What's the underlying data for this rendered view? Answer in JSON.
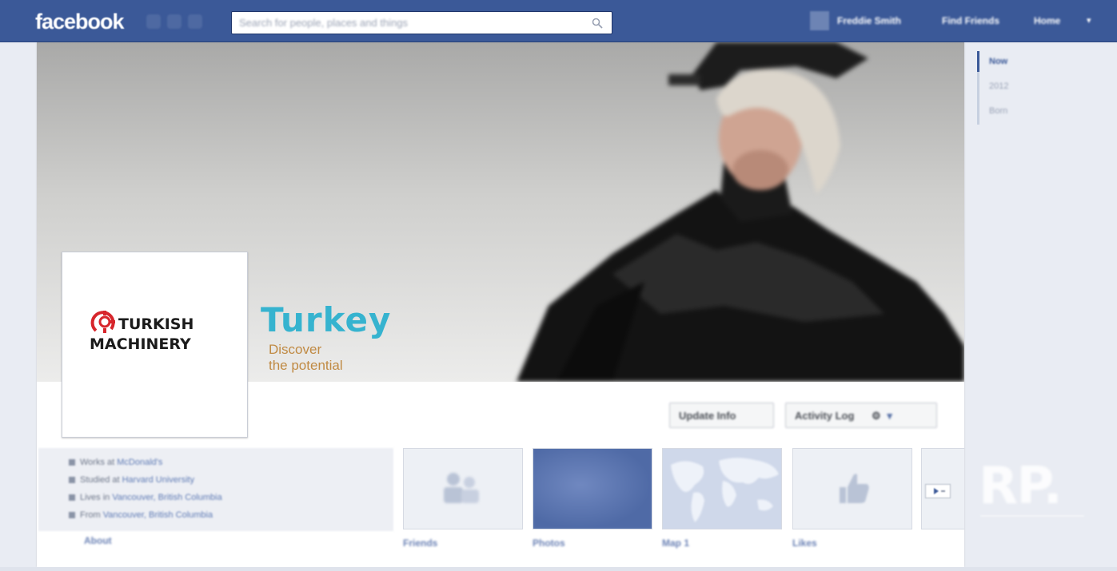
{
  "topbar": {
    "logo": "facebook",
    "search_placeholder": "Search for people, places and things",
    "user_name": "Freddie Smith",
    "find_friends": "Find Friends",
    "home": "Home"
  },
  "cover": {
    "turkey_word": "Turkey",
    "turkey_tagline_1": "Discover",
    "turkey_tagline_2": "the potential"
  },
  "profile": {
    "logo_line1": "TURKISH",
    "logo_line2": "MACHINERY"
  },
  "actions": {
    "update_info": "Update Info",
    "activity_log": "Activity Log"
  },
  "about": {
    "items": [
      {
        "prefix": "Works at",
        "link": "McDonald's"
      },
      {
        "prefix": "Studied at",
        "link": "Harvard University"
      },
      {
        "prefix": "Lives in",
        "link": "Vancouver, British Columbia"
      },
      {
        "prefix": "From",
        "link": "Vancouver, British Columbia"
      }
    ],
    "label": "About"
  },
  "tiles": [
    {
      "label": "Friends"
    },
    {
      "label": "Photos"
    },
    {
      "label": "Map 1"
    },
    {
      "label": "Likes"
    }
  ],
  "timeline": [
    "Now",
    "2012",
    "Born"
  ],
  "watermark": "RP.",
  "colors": {
    "facebook_blue": "#3b5998",
    "turkey_teal": "#36b3cf",
    "turkey_gold": "#c08a43",
    "machinery_red": "#d7262c"
  }
}
